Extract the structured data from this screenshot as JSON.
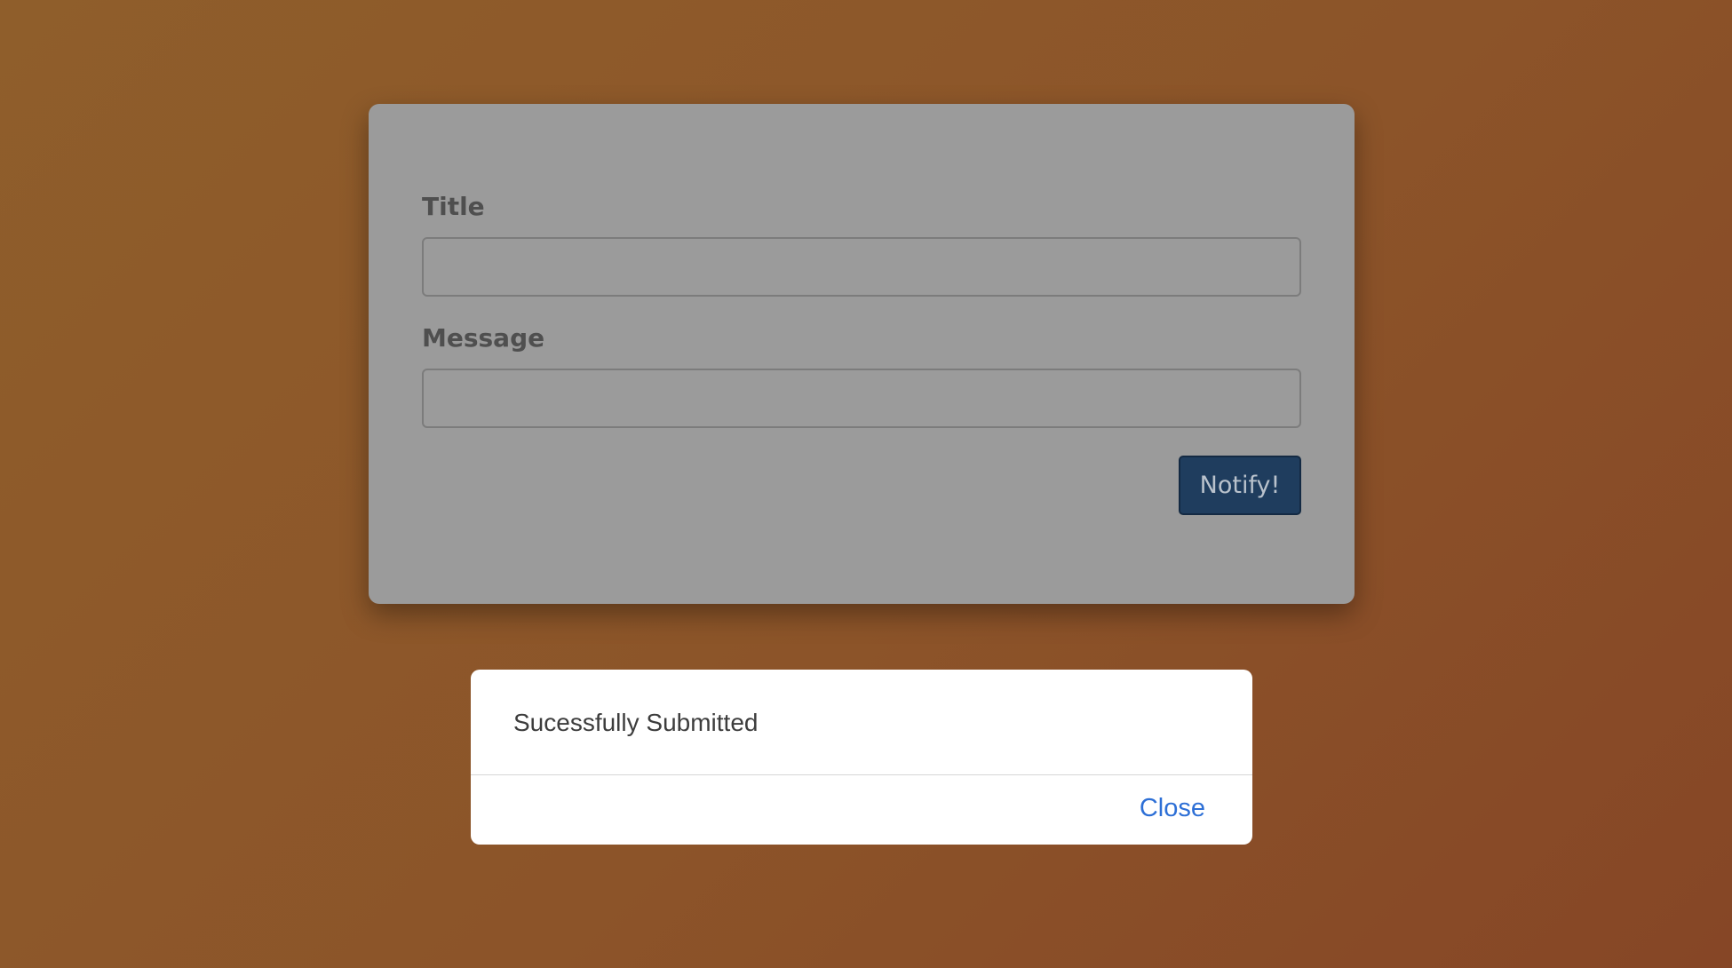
{
  "form": {
    "title_label": "Title",
    "title_value": "",
    "message_label": "Message",
    "message_value": "",
    "submit_label": "Notify!"
  },
  "dialog": {
    "message": "Sucessfully Submitted",
    "close_label": "Close"
  },
  "colors": {
    "background": "#8c5429",
    "card": "#9b9b9b",
    "submit_button": "#1f3d5e",
    "dialog_link": "#2d6fd6"
  }
}
